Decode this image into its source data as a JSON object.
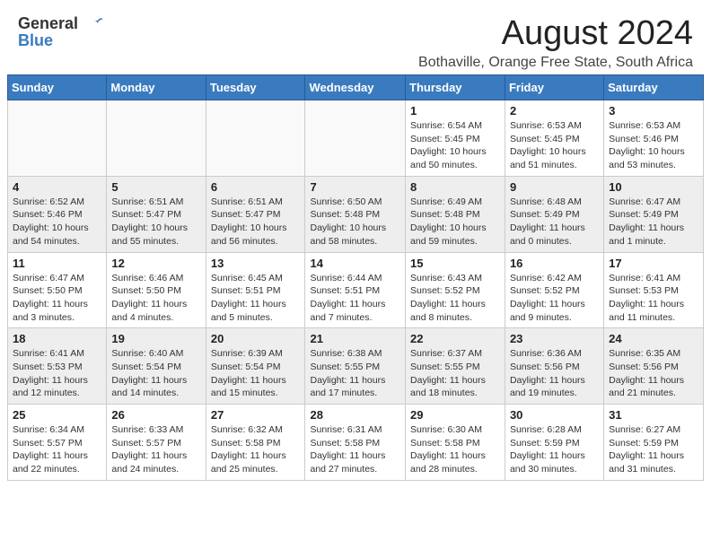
{
  "header": {
    "logo_general": "General",
    "logo_blue": "Blue",
    "title": "August 2024",
    "location": "Bothaville, Orange Free State, South Africa"
  },
  "days_of_week": [
    "Sunday",
    "Monday",
    "Tuesday",
    "Wednesday",
    "Thursday",
    "Friday",
    "Saturday"
  ],
  "weeks": [
    [
      {
        "day": "",
        "detail": ""
      },
      {
        "day": "",
        "detail": ""
      },
      {
        "day": "",
        "detail": ""
      },
      {
        "day": "",
        "detail": ""
      },
      {
        "day": "1",
        "detail": "Sunrise: 6:54 AM\nSunset: 5:45 PM\nDaylight: 10 hours\nand 50 minutes."
      },
      {
        "day": "2",
        "detail": "Sunrise: 6:53 AM\nSunset: 5:45 PM\nDaylight: 10 hours\nand 51 minutes."
      },
      {
        "day": "3",
        "detail": "Sunrise: 6:53 AM\nSunset: 5:46 PM\nDaylight: 10 hours\nand 53 minutes."
      }
    ],
    [
      {
        "day": "4",
        "detail": "Sunrise: 6:52 AM\nSunset: 5:46 PM\nDaylight: 10 hours\nand 54 minutes."
      },
      {
        "day": "5",
        "detail": "Sunrise: 6:51 AM\nSunset: 5:47 PM\nDaylight: 10 hours\nand 55 minutes."
      },
      {
        "day": "6",
        "detail": "Sunrise: 6:51 AM\nSunset: 5:47 PM\nDaylight: 10 hours\nand 56 minutes."
      },
      {
        "day": "7",
        "detail": "Sunrise: 6:50 AM\nSunset: 5:48 PM\nDaylight: 10 hours\nand 58 minutes."
      },
      {
        "day": "8",
        "detail": "Sunrise: 6:49 AM\nSunset: 5:48 PM\nDaylight: 10 hours\nand 59 minutes."
      },
      {
        "day": "9",
        "detail": "Sunrise: 6:48 AM\nSunset: 5:49 PM\nDaylight: 11 hours\nand 0 minutes."
      },
      {
        "day": "10",
        "detail": "Sunrise: 6:47 AM\nSunset: 5:49 PM\nDaylight: 11 hours\nand 1 minute."
      }
    ],
    [
      {
        "day": "11",
        "detail": "Sunrise: 6:47 AM\nSunset: 5:50 PM\nDaylight: 11 hours\nand 3 minutes."
      },
      {
        "day": "12",
        "detail": "Sunrise: 6:46 AM\nSunset: 5:50 PM\nDaylight: 11 hours\nand 4 minutes."
      },
      {
        "day": "13",
        "detail": "Sunrise: 6:45 AM\nSunset: 5:51 PM\nDaylight: 11 hours\nand 5 minutes."
      },
      {
        "day": "14",
        "detail": "Sunrise: 6:44 AM\nSunset: 5:51 PM\nDaylight: 11 hours\nand 7 minutes."
      },
      {
        "day": "15",
        "detail": "Sunrise: 6:43 AM\nSunset: 5:52 PM\nDaylight: 11 hours\nand 8 minutes."
      },
      {
        "day": "16",
        "detail": "Sunrise: 6:42 AM\nSunset: 5:52 PM\nDaylight: 11 hours\nand 9 minutes."
      },
      {
        "day": "17",
        "detail": "Sunrise: 6:41 AM\nSunset: 5:53 PM\nDaylight: 11 hours\nand 11 minutes."
      }
    ],
    [
      {
        "day": "18",
        "detail": "Sunrise: 6:41 AM\nSunset: 5:53 PM\nDaylight: 11 hours\nand 12 minutes."
      },
      {
        "day": "19",
        "detail": "Sunrise: 6:40 AM\nSunset: 5:54 PM\nDaylight: 11 hours\nand 14 minutes."
      },
      {
        "day": "20",
        "detail": "Sunrise: 6:39 AM\nSunset: 5:54 PM\nDaylight: 11 hours\nand 15 minutes."
      },
      {
        "day": "21",
        "detail": "Sunrise: 6:38 AM\nSunset: 5:55 PM\nDaylight: 11 hours\nand 17 minutes."
      },
      {
        "day": "22",
        "detail": "Sunrise: 6:37 AM\nSunset: 5:55 PM\nDaylight: 11 hours\nand 18 minutes."
      },
      {
        "day": "23",
        "detail": "Sunrise: 6:36 AM\nSunset: 5:56 PM\nDaylight: 11 hours\nand 19 minutes."
      },
      {
        "day": "24",
        "detail": "Sunrise: 6:35 AM\nSunset: 5:56 PM\nDaylight: 11 hours\nand 21 minutes."
      }
    ],
    [
      {
        "day": "25",
        "detail": "Sunrise: 6:34 AM\nSunset: 5:57 PM\nDaylight: 11 hours\nand 22 minutes."
      },
      {
        "day": "26",
        "detail": "Sunrise: 6:33 AM\nSunset: 5:57 PM\nDaylight: 11 hours\nand 24 minutes."
      },
      {
        "day": "27",
        "detail": "Sunrise: 6:32 AM\nSunset: 5:58 PM\nDaylight: 11 hours\nand 25 minutes."
      },
      {
        "day": "28",
        "detail": "Sunrise: 6:31 AM\nSunset: 5:58 PM\nDaylight: 11 hours\nand 27 minutes."
      },
      {
        "day": "29",
        "detail": "Sunrise: 6:30 AM\nSunset: 5:58 PM\nDaylight: 11 hours\nand 28 minutes."
      },
      {
        "day": "30",
        "detail": "Sunrise: 6:28 AM\nSunset: 5:59 PM\nDaylight: 11 hours\nand 30 minutes."
      },
      {
        "day": "31",
        "detail": "Sunrise: 6:27 AM\nSunset: 5:59 PM\nDaylight: 11 hours\nand 31 minutes."
      }
    ]
  ]
}
